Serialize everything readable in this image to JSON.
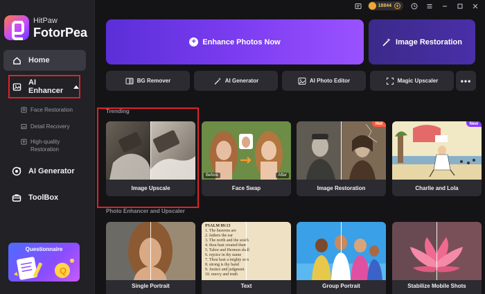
{
  "brand": {
    "sub": "HitPaw",
    "name": "FotorPea"
  },
  "sidebar": {
    "home": "Home",
    "ai_enhancer": "AI Enhancer",
    "sub_items": [
      {
        "label": "Face Restoration",
        "icon": "face-icon"
      },
      {
        "label": "Detail Recovery",
        "icon": "image-icon"
      },
      {
        "label": "High-quality\nRestoration",
        "icon": "hq-icon"
      }
    ],
    "ai_generator": "AI Generator",
    "toolbox": "ToolBox",
    "questionnaire": "Questionnaire"
  },
  "titlebar": {
    "credits": "18844"
  },
  "hero": {
    "enhance": "Enhance Photos Now",
    "restore": "Image Restoration"
  },
  "tools": [
    {
      "label": "BG Remover",
      "icon": "bg-remover-icon"
    },
    {
      "label": "AI Generator",
      "icon": "magic-wand-icon"
    },
    {
      "label": "AI Photo Editor",
      "icon": "photo-editor-icon"
    },
    {
      "label": "Magic Upscaler",
      "icon": "upscale-icon"
    }
  ],
  "trending": {
    "title": "Trending",
    "cards": [
      {
        "label": "Image Upscale"
      },
      {
        "label": "Face Swap",
        "before": "Before",
        "after": "After"
      },
      {
        "label": "Image Restoration",
        "badge": "Hot"
      },
      {
        "label": "Charlie and Lola",
        "badge": "New"
      }
    ]
  },
  "enhancer": {
    "title": "Photo Enhancer and Upscaler",
    "cards": [
      {
        "label": "Single Portrait"
      },
      {
        "label": "Text",
        "text_lines": [
          "PSALM 89:13",
          "1. The heavens are",
          "2. fathers the ear",
          "3. The north and the south",
          "4. thou hast created them",
          "5. Tabor and Hermon shall",
          "6. rejoice in thy name",
          "7. Thou hast a mighty arm",
          "8. strong is thy hand",
          "9. Justice and judgment",
          "10. mercy and truth"
        ]
      },
      {
        "label": "Group Portrait"
      },
      {
        "label": "Stabilize Mobile Shots"
      }
    ]
  }
}
